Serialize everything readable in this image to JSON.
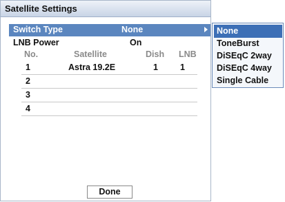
{
  "dialog": {
    "title": "Satellite Settings",
    "switch_type": {
      "label": "Switch Type",
      "value": "None"
    },
    "lnb_power": {
      "label": "LNB Power",
      "value": "On"
    },
    "table": {
      "headers": [
        "No.",
        "Satellite",
        "Dish",
        "LNB"
      ],
      "rows": [
        [
          "1",
          "Astra 19.2E",
          "1",
          "1"
        ],
        [
          "2",
          "",
          "",
          ""
        ],
        [
          "3",
          "",
          "",
          ""
        ],
        [
          "4",
          "",
          "",
          ""
        ]
      ]
    },
    "done_label": "Done"
  },
  "dropdown": {
    "options": [
      "None",
      "ToneBurst",
      "DiSEqC 2way",
      "DiSEqC 4way",
      "Single Cable"
    ],
    "selected_index": 0
  },
  "colors": {
    "highlight": "#5b86bf",
    "selected_option": "#3c6fb6",
    "header_text": "#8a8a8a"
  }
}
